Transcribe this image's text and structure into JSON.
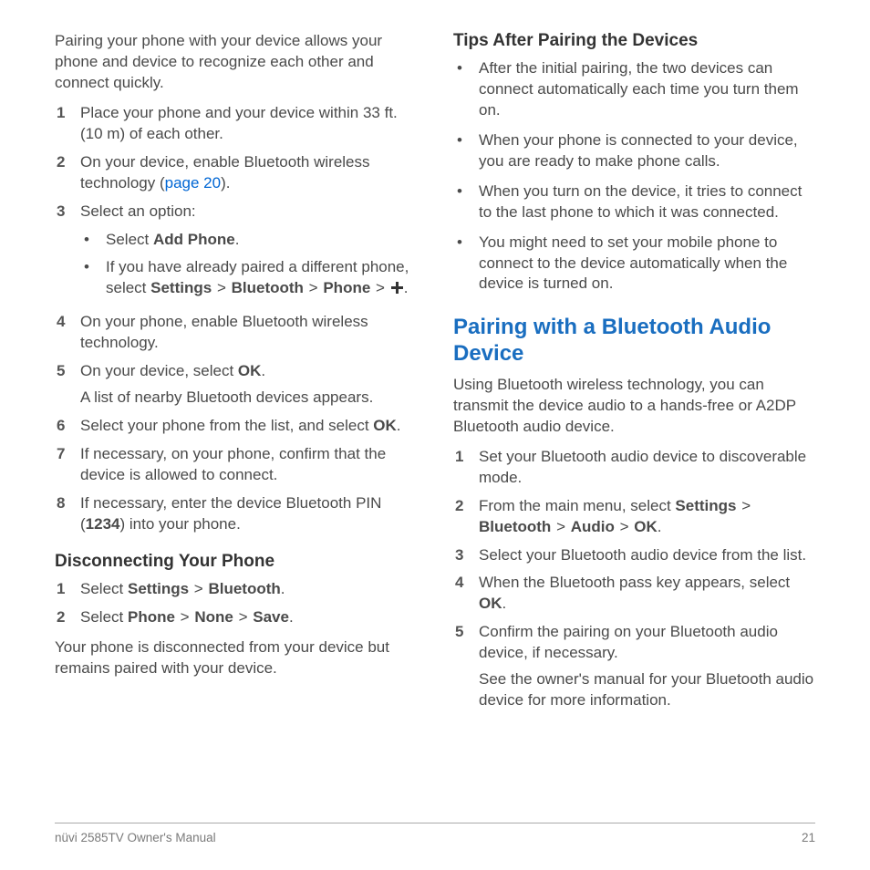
{
  "left": {
    "intro": "Pairing your phone with your device allows your phone and device to recognize each other and connect quickly.",
    "steps": {
      "s1": "Place your phone and your device within 33 ft. (10 m) of each other.",
      "s2a": "On your device, enable Bluetooth wireless technology (",
      "s2link": "page 20",
      "s2b": ").",
      "s3": "Select an option:",
      "s3_sub1a": "Select ",
      "s3_sub1b": "Add Phone",
      "s3_sub1c": ".",
      "s3_sub2a": "If you have already paired a different phone, select ",
      "s3_sub2_settings": "Settings",
      "s3_sub2_bt": "Bluetooth",
      "s3_sub2_phone": "Phone",
      "s3_sub2_dot": ".",
      "s4": "On your phone, enable Bluetooth wireless technology.",
      "s5a": "On your device, select ",
      "s5ok": "OK",
      "s5dot": ".",
      "s5p2": "A list of nearby Bluetooth devices appears.",
      "s6a": "Select your phone from the list, and select ",
      "s6ok": "OK",
      "s6dot": ".",
      "s7": "If necessary, on your phone, confirm that the device is allowed to connect.",
      "s8a": "If necessary, enter the device Bluetooth PIN (",
      "s8pin": "1234",
      "s8b": ") into your phone."
    },
    "disconnect": {
      "heading": "Disconnecting Your Phone",
      "s1a": "Select ",
      "s1_settings": "Settings",
      "s1_bt": "Bluetooth",
      "s1dot": ".",
      "s2a": "Select ",
      "s2_phone": "Phone",
      "s2_none": "None",
      "s2_save": "Save",
      "s2dot": ".",
      "after": "Your phone is disconnected from your device but remains paired with your device."
    }
  },
  "right": {
    "tips": {
      "heading": "Tips After Pairing the Devices",
      "b1": "After the initial pairing, the two devices can connect automatically each time you turn them on.",
      "b2": "When your phone is connected to your device, you are ready to make phone calls.",
      "b3": "When you turn on the device, it tries to connect to the last phone to which it was connected.",
      "b4": "You might need to set your mobile phone to connect to the device automatically when the device is turned on."
    },
    "audio": {
      "heading": "Pairing with a Bluetooth Audio Device",
      "intro": "Using Bluetooth wireless technology, you can transmit the device audio to a hands-free or A2DP Bluetooth audio device.",
      "s1": "Set your Bluetooth audio device to discoverable mode.",
      "s2a": "From the main menu, select ",
      "s2_settings": "Settings",
      "s2_bt": "Bluetooth",
      "s2_audio": "Audio",
      "s2_ok": "OK",
      "s2dot": ".",
      "s3": "Select your Bluetooth audio device from the list.",
      "s4a": "When the Bluetooth pass key appears, select ",
      "s4_ok": "OK",
      "s4dot": ".",
      "s5": "Confirm the pairing on your Bluetooth audio device, if necessary.",
      "s5p2": "See the owner's manual for your Bluetooth audio device for more information."
    }
  },
  "footer": {
    "left": "nüvi 2585TV Owner's Manual",
    "right": "21"
  },
  "gt": ">"
}
